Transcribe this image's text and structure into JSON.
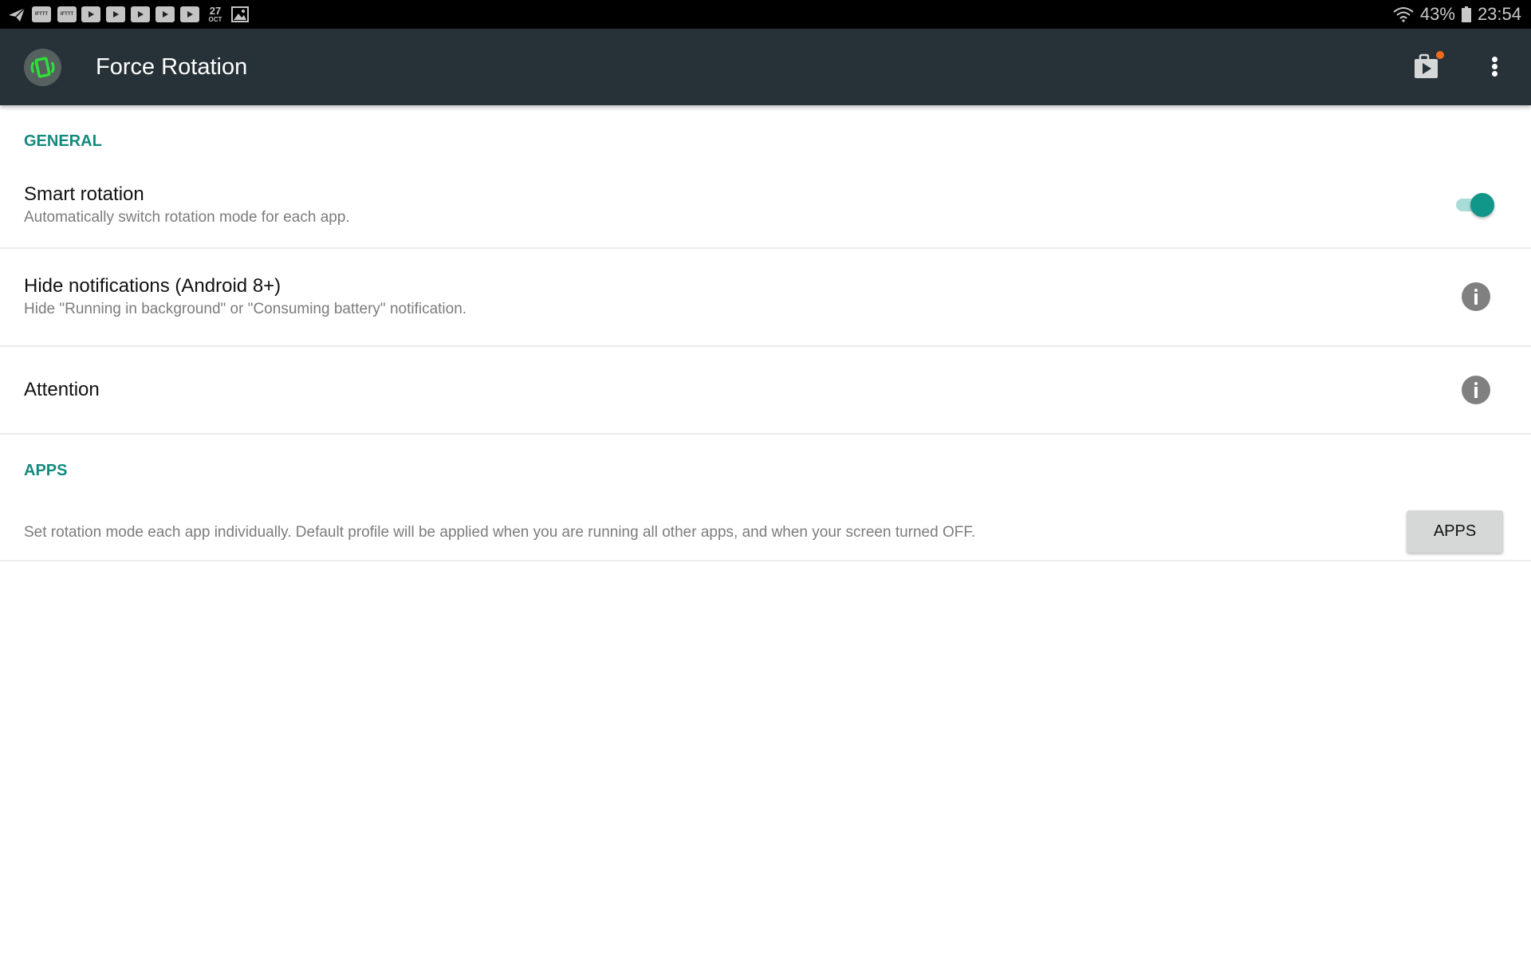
{
  "status_bar": {
    "notification_icons": [
      "telegram-icon",
      "ifttt-icon",
      "ifttt-icon",
      "youtube-icon",
      "youtube-icon",
      "youtube-icon",
      "youtube-icon",
      "youtube-icon",
      "calendar-icon",
      "gallery-icon"
    ],
    "ifttt_label": "IFTTT",
    "calendar_day": "27",
    "calendar_month": "OCT",
    "battery": "43%",
    "time": "23:54"
  },
  "app_bar": {
    "title": "Force Rotation",
    "play_store_badge_color": "#f26b1d"
  },
  "sections": {
    "general": {
      "header": "GENERAL",
      "items": [
        {
          "title": "Smart rotation",
          "subtitle": "Automatically switch rotation mode for each app.",
          "control": "toggle",
          "checked": true
        },
        {
          "title": "Hide notifications (Android 8+)",
          "subtitle": "Hide \"Running in background\" or \"Consuming battery\" notification.",
          "control": "info"
        },
        {
          "title": "Attention",
          "control": "info"
        }
      ]
    },
    "apps": {
      "header": "APPS",
      "description": "Set rotation mode each app individually. Default profile will be applied when you are running all other apps, and when your screen turned OFF.",
      "button_label": "APPS"
    }
  },
  "colors": {
    "app_bar": "#263238",
    "accent": "#138a7e",
    "toggle_thumb": "#11968a",
    "toggle_track": "#a9dcd8",
    "logo_green": "#2fe03a"
  }
}
